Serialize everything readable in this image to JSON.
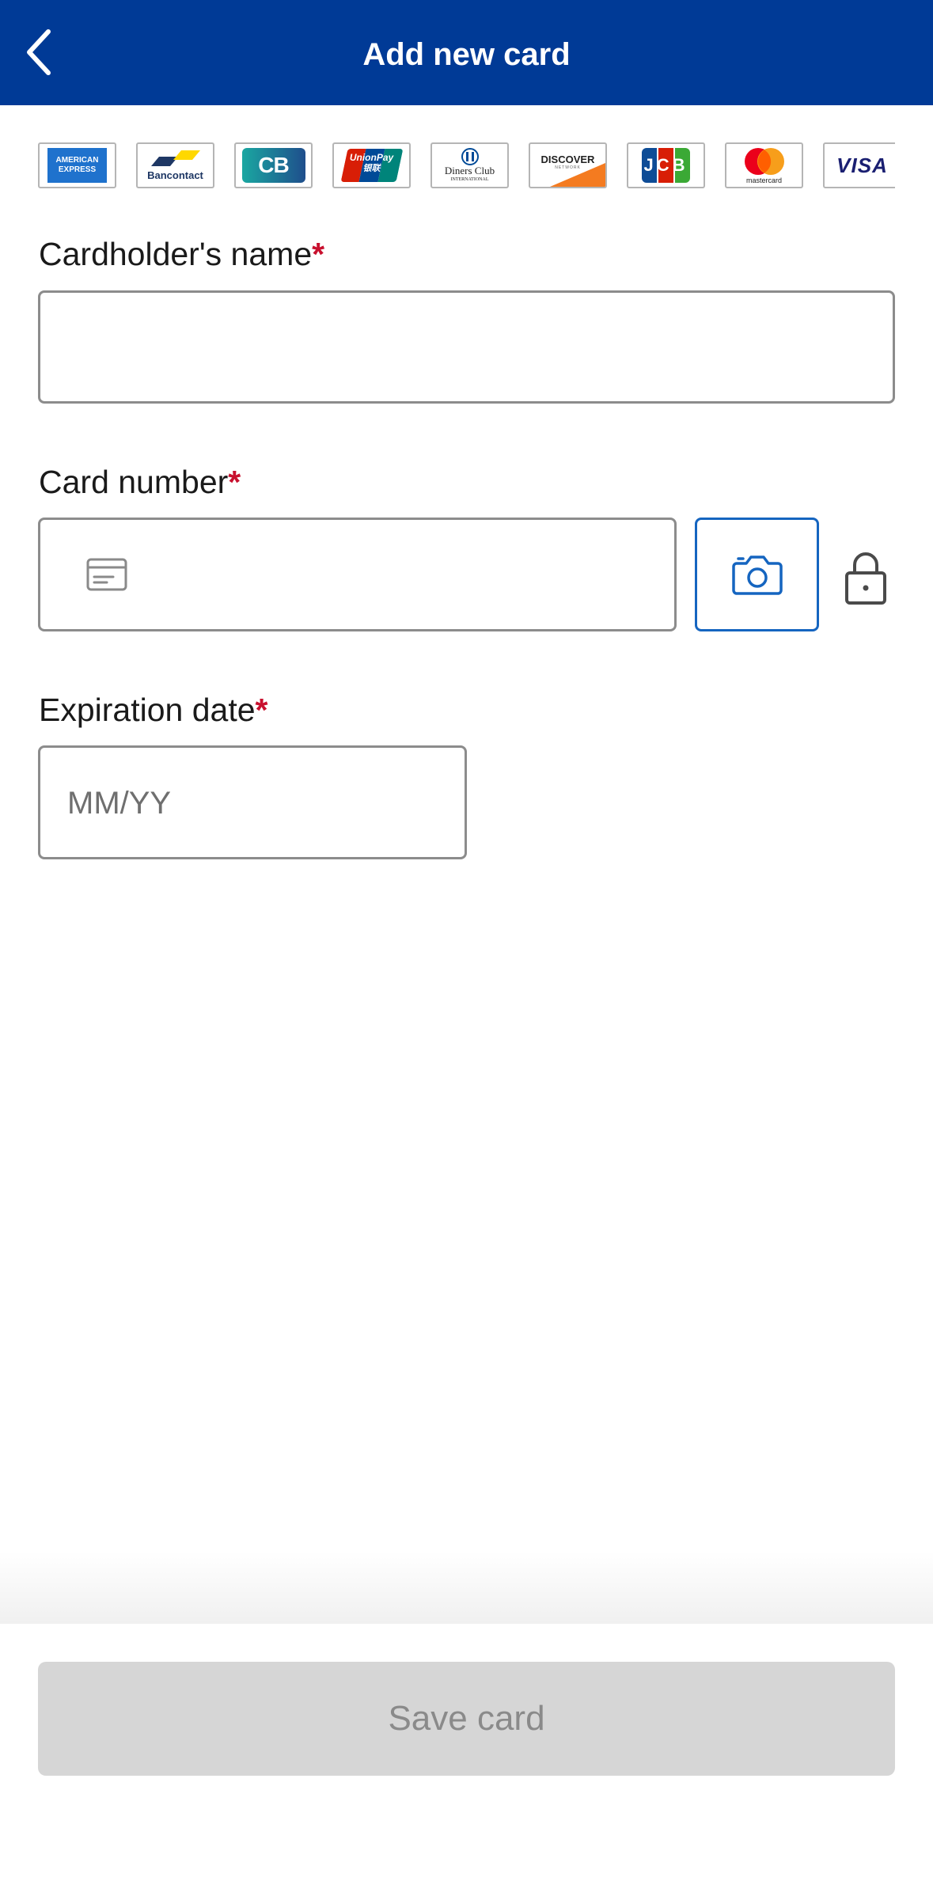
{
  "header": {
    "title": "Add new card",
    "back_icon": "chevron-left-icon"
  },
  "card_brands": [
    {
      "name": "American Express",
      "label_top": "AMERICAN",
      "label_bottom": "EXPRESS",
      "color": "#1f72cd"
    },
    {
      "name": "Bancontact",
      "label": "Bancontact",
      "color": "#1e3764"
    },
    {
      "name": "CB",
      "label": "CB",
      "color": "#0f8a9d"
    },
    {
      "name": "UnionPay",
      "label": "UnionPay",
      "label_cn": "银联",
      "color": "#d81e06"
    },
    {
      "name": "Diners Club",
      "label_top": "Diners Club",
      "label_bottom": "INTERNATIONAL",
      "color": "#004a97"
    },
    {
      "name": "Discover",
      "label": "DISCOVER",
      "label_bottom": "NETWORK",
      "color": "#f47b20"
    },
    {
      "name": "JCB",
      "label": "JCB",
      "color": "#0e4c96"
    },
    {
      "name": "Mastercard",
      "label": "mastercard",
      "color": "#eb001b"
    },
    {
      "name": "Visa",
      "label": "VISA",
      "color": "#1a1f71"
    }
  ],
  "form": {
    "cardholder": {
      "label": "Cardholder's name",
      "required_mark": "*",
      "value": ""
    },
    "card_number": {
      "label": "Card number",
      "required_mark": "*",
      "value": "",
      "icon": "credit-card-icon",
      "scan_icon": "camera-icon",
      "secure_icon": "lock-icon"
    },
    "expiry": {
      "label": "Expiration date",
      "required_mark": "*",
      "placeholder": "MM/YY",
      "value": ""
    }
  },
  "footer": {
    "save_label": "Save card"
  },
  "colors": {
    "header_bg": "#003a96",
    "required": "#c8102e",
    "accent": "#1565c0",
    "button_disabled_bg": "#d6d6d6",
    "button_disabled_text": "#8a8a8a"
  }
}
